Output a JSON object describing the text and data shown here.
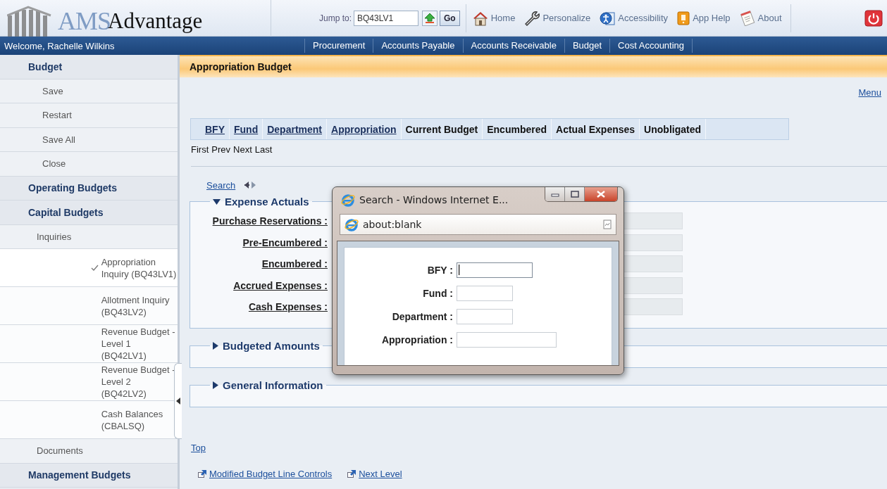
{
  "header": {
    "logo": {
      "prefix": "AMS",
      "name": "Advantage"
    },
    "jump_to": {
      "label": "Jump to:",
      "value": "BQ43LV1"
    },
    "go_button": "Go",
    "links": [
      {
        "kind": "home",
        "label": "Home"
      },
      {
        "kind": "personalize",
        "label": "Personalize"
      },
      {
        "kind": "accessibility",
        "label": "Accessibility"
      },
      {
        "kind": "help",
        "label": "App Help"
      },
      {
        "kind": "about",
        "label": "About"
      }
    ]
  },
  "nav": {
    "welcome": "Welcome, Rachelle Wilkins",
    "tabs": [
      "Procurement",
      "Accounts Payable",
      "Accounts Receivable",
      "Budget",
      "Cost Accounting"
    ]
  },
  "sidebar": {
    "items": [
      {
        "kind": "section",
        "label": "Budget"
      },
      {
        "kind": "action",
        "label": "Save"
      },
      {
        "kind": "action",
        "label": "Restart"
      },
      {
        "kind": "action",
        "label": "Save All"
      },
      {
        "kind": "action",
        "label": "Close"
      },
      {
        "kind": "section",
        "label": "Operating Budgets"
      },
      {
        "kind": "section",
        "label": "Capital Budgets"
      },
      {
        "kind": "group",
        "label": "Inquiries"
      },
      {
        "kind": "page",
        "label": "Appropriation Inquiry (BQ43LV1)",
        "selected": true
      },
      {
        "kind": "page",
        "label": "Allotment Inquiry (BQ43LV2)",
        "selected": false
      },
      {
        "kind": "page",
        "label": "Revenue Budget - Level 1 (BQ42LV1)",
        "selected": false
      },
      {
        "kind": "page",
        "label": "Revenue Budget - Level 2 (BQ42LV2)",
        "selected": false
      },
      {
        "kind": "page",
        "label": "Cash Balances (CBALSQ)",
        "selected": false
      },
      {
        "kind": "group",
        "label": "Documents"
      },
      {
        "kind": "section",
        "label": "Management Budgets"
      }
    ]
  },
  "main": {
    "title": "Appropriation Budget",
    "menu_link": "Menu",
    "table": {
      "columns": [
        {
          "label": "BFY",
          "sortable": true
        },
        {
          "label": "Fund",
          "sortable": true
        },
        {
          "label": "Department",
          "sortable": true
        },
        {
          "label": "Appropriation",
          "sortable": true
        },
        {
          "label": "Current Budget",
          "sortable": false
        },
        {
          "label": "Encumbered",
          "sortable": false
        },
        {
          "label": "Actual Expenses",
          "sortable": false
        },
        {
          "label": "Unobligated",
          "sortable": false
        }
      ]
    },
    "pager": [
      "First",
      "Prev",
      "Next",
      "Last"
    ],
    "search_link": "Search",
    "sections": [
      {
        "title": "Expense Actuals",
        "expanded": true,
        "fields": [
          "Purchase Reservations :",
          "Pre-Encumbered :",
          "Encumbered :",
          "Accrued Expenses :",
          "Cash Expenses :"
        ]
      },
      {
        "title": "Budgeted Amounts",
        "expanded": false
      },
      {
        "title": "General Information",
        "expanded": false
      }
    ],
    "top_link": "Top",
    "footer_links": [
      "Modified Budget Line Controls",
      "Next Level"
    ]
  },
  "popup": {
    "title": "Search - Windows Internet E...",
    "address": "about:blank",
    "fields": [
      {
        "label": "BFY :",
        "focused": true
      },
      {
        "label": "Fund :",
        "focused": false
      },
      {
        "label": "Department :",
        "focused": false
      },
      {
        "label": "Appropriation :",
        "focused": false
      }
    ]
  }
}
